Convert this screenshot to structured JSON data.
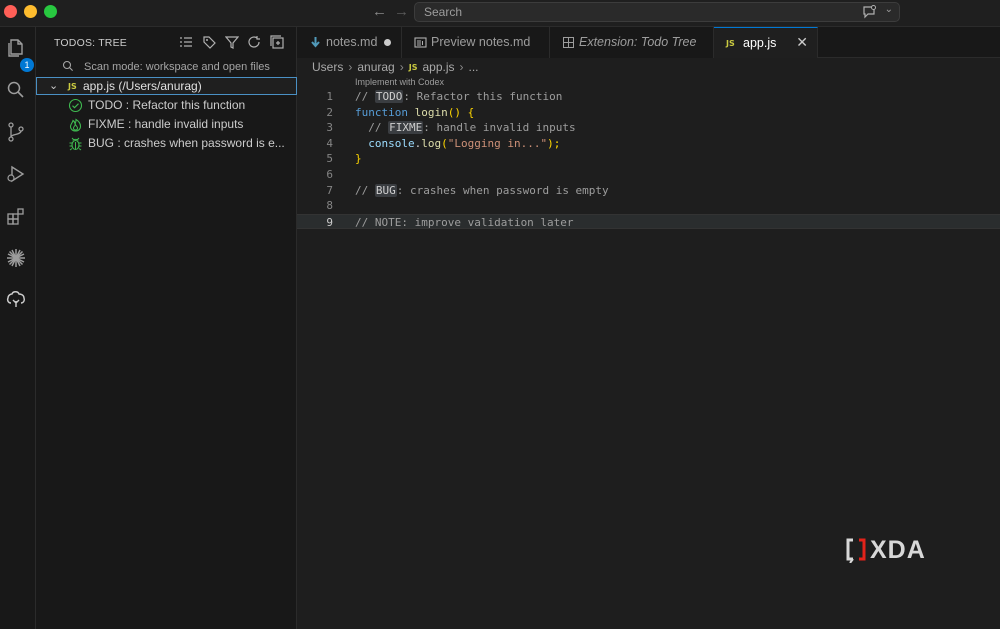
{
  "titlebar": {
    "search_placeholder": "Search"
  },
  "activity_bar": {
    "explorer_badge": "1",
    "items": [
      "explorer",
      "search",
      "source-control",
      "run-debug",
      "extensions",
      "codex",
      "todo-tree"
    ]
  },
  "sidebar": {
    "title": "TODOS: TREE",
    "scan_mode": "Scan mode: workspace and open files",
    "root": {
      "icon": "JS",
      "label": "app.js (/Users/anurag)"
    },
    "items": [
      {
        "icon": "check-circle-icon",
        "label": "TODO : Refactor this function",
        "color": "#3fb950"
      },
      {
        "icon": "flame-icon",
        "label": "FIXME : handle invalid inputs",
        "color": "#3fb950"
      },
      {
        "icon": "bug-icon",
        "label": "BUG : crashes when password is e...",
        "color": "#3fb950"
      }
    ]
  },
  "tabs": [
    {
      "label": "notes.md",
      "icon": "markdown-icon",
      "dirty": true
    },
    {
      "label": "Preview notes.md",
      "icon": "preview-icon"
    },
    {
      "label": "Extension: Todo Tree",
      "icon": "extension-icon"
    },
    {
      "label": "app.js",
      "icon": "JS",
      "active": true
    }
  ],
  "breadcrumb": [
    "Users",
    "anurag",
    "app.js",
    "..."
  ],
  "editor": {
    "codelens": "Implement with Codex",
    "line_numbers": [
      "1",
      "2",
      "3",
      "4",
      "5",
      "6",
      "7",
      "8",
      "9"
    ],
    "current_line": 9,
    "code": {
      "l1_prefix": "// ",
      "l1_tag": "TODO",
      "l1_rest": ": Refactor this function",
      "l2_kw": "function",
      "l2_fn": "login",
      "l2_paren": "()",
      "l2_brace": "{",
      "l3_prefix": "  // ",
      "l3_tag": "FIXME",
      "l3_rest": ": handle invalid inputs",
      "l4_obj": "console",
      "l4_dot": ".",
      "l4_fn": "log",
      "l4_open": "(",
      "l4_str": "\"Logging in...\"",
      "l4_close": ");",
      "l5": "}",
      "l7_prefix": "// ",
      "l7_tag": "BUG",
      "l7_rest": ": crashes when password is empty",
      "l9": "// NOTE: improve validation later"
    }
  },
  "watermark": "XDA"
}
